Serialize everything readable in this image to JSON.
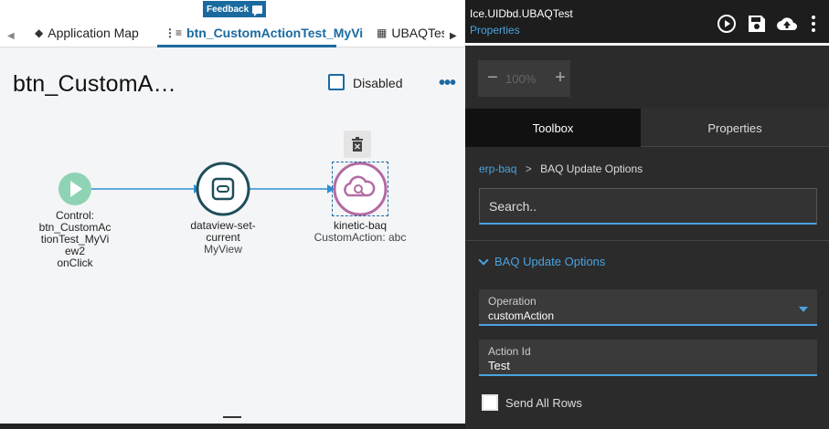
{
  "feedback": {
    "label": "Feedback"
  },
  "tabs": [
    {
      "label": "Application Map",
      "icon": "layers-icon"
    },
    {
      "label": "btn_CustomActionTest_MyVi",
      "icon": "workflow-icon",
      "active": true
    },
    {
      "label": "UBAQTest",
      "icon": "table-icon"
    }
  ],
  "canvas": {
    "title": "btn_CustomA…",
    "disabled_label": "Disabled",
    "more_label": "•••"
  },
  "flow": {
    "nodes": [
      {
        "lines": [
          "Control:",
          "btn_CustomAc",
          "tionTest_MyVi",
          "ew2",
          "onClick"
        ],
        "sub": "",
        "color": "#8ed3b4"
      },
      {
        "lines": [
          "dataview-set-",
          "current"
        ],
        "sub": "MyView",
        "color": "#1e4e5a"
      },
      {
        "lines": [
          "kinetic-baq"
        ],
        "sub": "CustomAction: abc",
        "color": "#b36aa3"
      }
    ]
  },
  "right": {
    "title": "Ice.UIDbd.UBAQTest",
    "subtitle": "Properties",
    "zoom": {
      "minus": "−",
      "value": "100%",
      "plus": "+"
    },
    "tabs": {
      "toolbox": "Toolbox",
      "properties": "Properties"
    },
    "breadcrumb": {
      "root": "erp-baq",
      "sep": ">",
      "current": "BAQ Update Options"
    },
    "search": {
      "placeholder": "Search.."
    },
    "section": {
      "title": "BAQ Update Options"
    },
    "operation": {
      "label": "Operation",
      "value": "customAction"
    },
    "action_id": {
      "label": "Action Id",
      "value": "Test"
    },
    "send_all_rows": {
      "label": "Send All Rows",
      "checked": false
    }
  },
  "colors": {
    "accent": "#1a6aa0",
    "accent_dark_theme": "#4aa3e0"
  }
}
